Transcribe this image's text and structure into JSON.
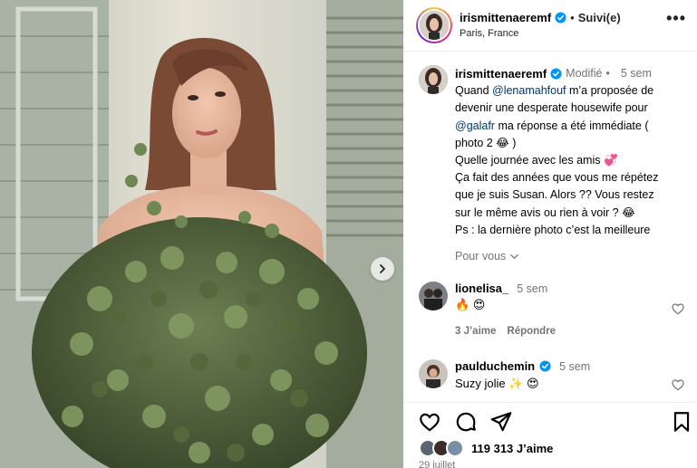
{
  "post": {
    "username": "irismittenaeremf",
    "separator": "•",
    "follow_state": "Suivi(e)",
    "location": "Paris, France",
    "more": "•••"
  },
  "caption": {
    "username": "irismittenaeremf",
    "edited": "Modifié",
    "separator": "•",
    "time": "5 sem",
    "line1_a": "Quand ",
    "line1_mention": "@lenamahfouf",
    "line1_b": " m’a proposée de",
    "line2": "devenir une desperate housewife pour",
    "line3_mention": "@galafr",
    "line3_b": " ma réponse a été immédiate (",
    "line4": "photo 2 😂 )",
    "line5": "Quelle journée avec les amis 💞",
    "line6": "Ça fait des années que vous me répétez",
    "line7": "que je suis Susan. Alors ?? Vous restez",
    "line8": "sur le même avis ou rien à voir ? 😂",
    "line9": "Ps : la dernière photo c’est la meilleure"
  },
  "for_you": "Pour vous",
  "comments": [
    {
      "username": "lionelisa_",
      "time": "5 sem",
      "text": "🔥 😍",
      "likes": "3 J’aime",
      "reply": "Répondre"
    },
    {
      "username": "paulduchemin",
      "time": "5 sem",
      "text": "Suzy jolie ✨ 😍"
    }
  ],
  "likes": {
    "count_text": "119 313 J’aime"
  },
  "date": "29 juillet",
  "icons": {
    "verified": "verified-badge-icon",
    "like": "heart-icon",
    "comment": "comment-bubble-icon",
    "share": "paper-plane-icon",
    "save": "bookmark-icon",
    "next": "chevron-right-icon"
  },
  "colors": {
    "verified": "#0095f6",
    "mention": "#00376b",
    "muted": "#737373"
  }
}
